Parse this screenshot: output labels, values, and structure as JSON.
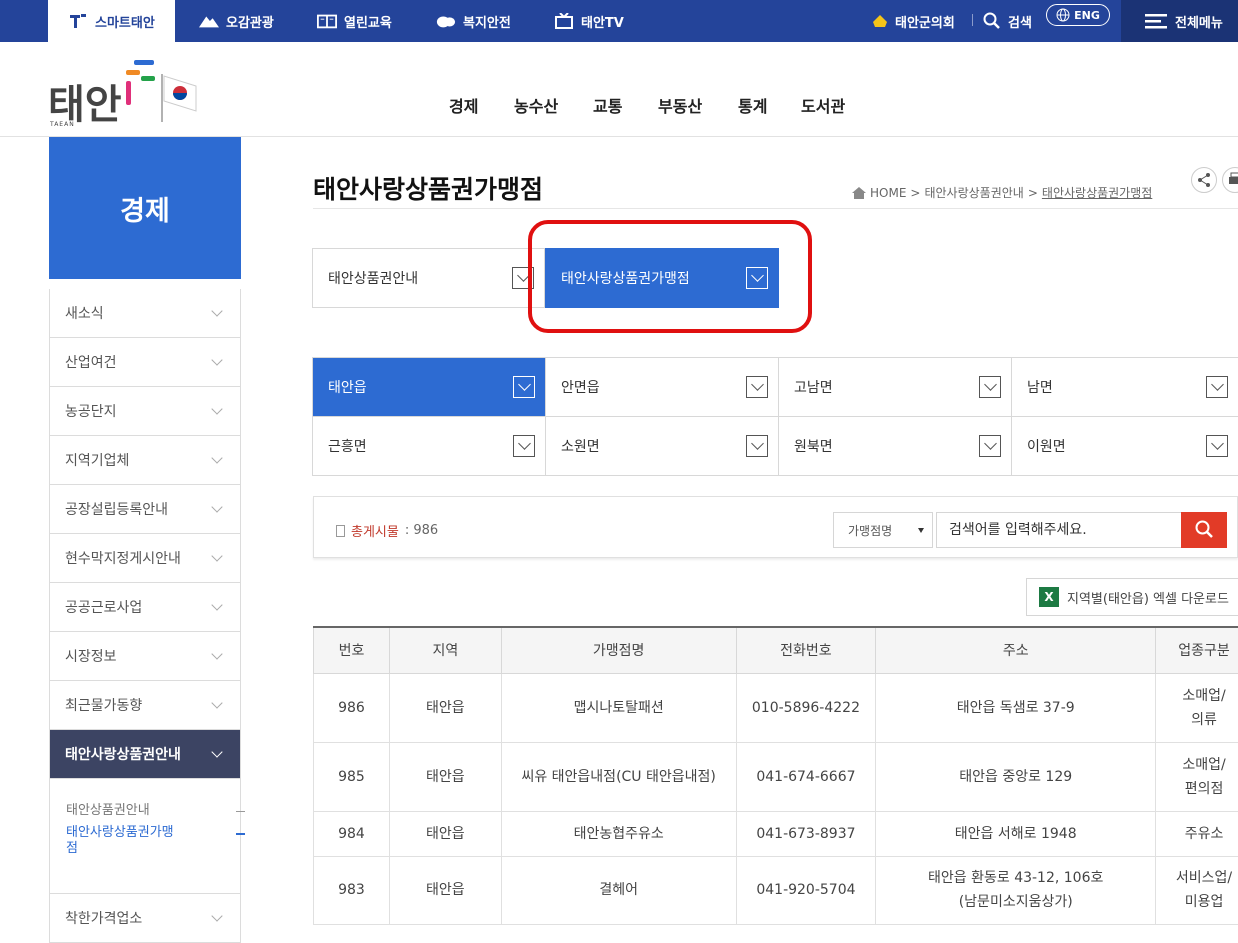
{
  "topbar": {
    "tabs": [
      {
        "label": "스마트태안",
        "icon": "smart-taean-icon"
      },
      {
        "label": "오감관광",
        "icon": "mountain-icon"
      },
      {
        "label": "열린교육",
        "icon": "book-icon"
      },
      {
        "label": "복지안전",
        "icon": "cloud-icon"
      },
      {
        "label": "태안TV",
        "icon": "tv-icon"
      }
    ],
    "council": "태안군의회",
    "search": "검색",
    "eng": "ENG",
    "all_menu": "전체메뉴"
  },
  "header": {
    "logo_text": "태안",
    "logo_sub": "TAEAN",
    "nav": [
      "경제",
      "농수산",
      "교통",
      "부동산",
      "통계",
      "도서관"
    ]
  },
  "sidebar": {
    "title": "경제",
    "items": [
      "새소식",
      "산업여건",
      "농공단지",
      "지역기업체",
      "공장설립등록안내",
      "현수막지정게시안내",
      "공공근로사업",
      "시장정보",
      "최근물가동향",
      "태안사랑상품권안내"
    ],
    "subitems": [
      "태안상품권안내",
      "태안사랑상품권가맹점"
    ],
    "after": "착한가격업소"
  },
  "content": {
    "title": "태안사랑상품권가맹점",
    "breadcrumb": [
      "HOME",
      "태안사랑상품권안내",
      "태안사랑상품권가맹점"
    ],
    "tabs": [
      "태안상품권안내",
      "태안사랑상품권가맹점"
    ],
    "regions": [
      "태안읍",
      "안면읍",
      "고남면",
      "남면",
      "근흥면",
      "소원면",
      "원북면",
      "이원면"
    ],
    "count_label": "총게시물",
    "count_value": ": 986",
    "select_value": "가맹점명",
    "search_placeholder": "검색어를 입력해주세요.",
    "excel_label": "지역별(태안읍) 엑셀 다운로드"
  },
  "table": {
    "headers": [
      "번호",
      "지역",
      "가맹점명",
      "전화번호",
      "주소",
      "업종구분"
    ],
    "rows": [
      {
        "no": "986",
        "region": "태안읍",
        "name": "맵시나토탈패션",
        "phone": "010-5896-4222",
        "addr1": "태안읍 독샘로 37-9",
        "addr2": "",
        "type1": "소매업/",
        "type2": "의류"
      },
      {
        "no": "985",
        "region": "태안읍",
        "name": "씨유 태안읍내점(CU 태안읍내점)",
        "phone": "041-674-6667",
        "addr1": "태안읍 중앙로 129",
        "addr2": "",
        "type1": "소매업/",
        "type2": "편의점"
      },
      {
        "no": "984",
        "region": "태안읍",
        "name": "태안농협주유소",
        "phone": "041-673-8937",
        "addr1": "태안읍 서해로 1948",
        "addr2": "",
        "type1": "주유소",
        "type2": ""
      },
      {
        "no": "983",
        "region": "태안읍",
        "name": "결헤어",
        "phone": "041-920-5704",
        "addr1": "태안읍 환동로 43-12, 106호",
        "addr2": "(남문미소지움상가)",
        "type1": "서비스업/",
        "type2": "미용업"
      }
    ]
  },
  "colors": {
    "primary": "#2d6bd2",
    "topbar": "#24449a",
    "highlight": "#e01010",
    "search_btn": "#e23b27"
  }
}
